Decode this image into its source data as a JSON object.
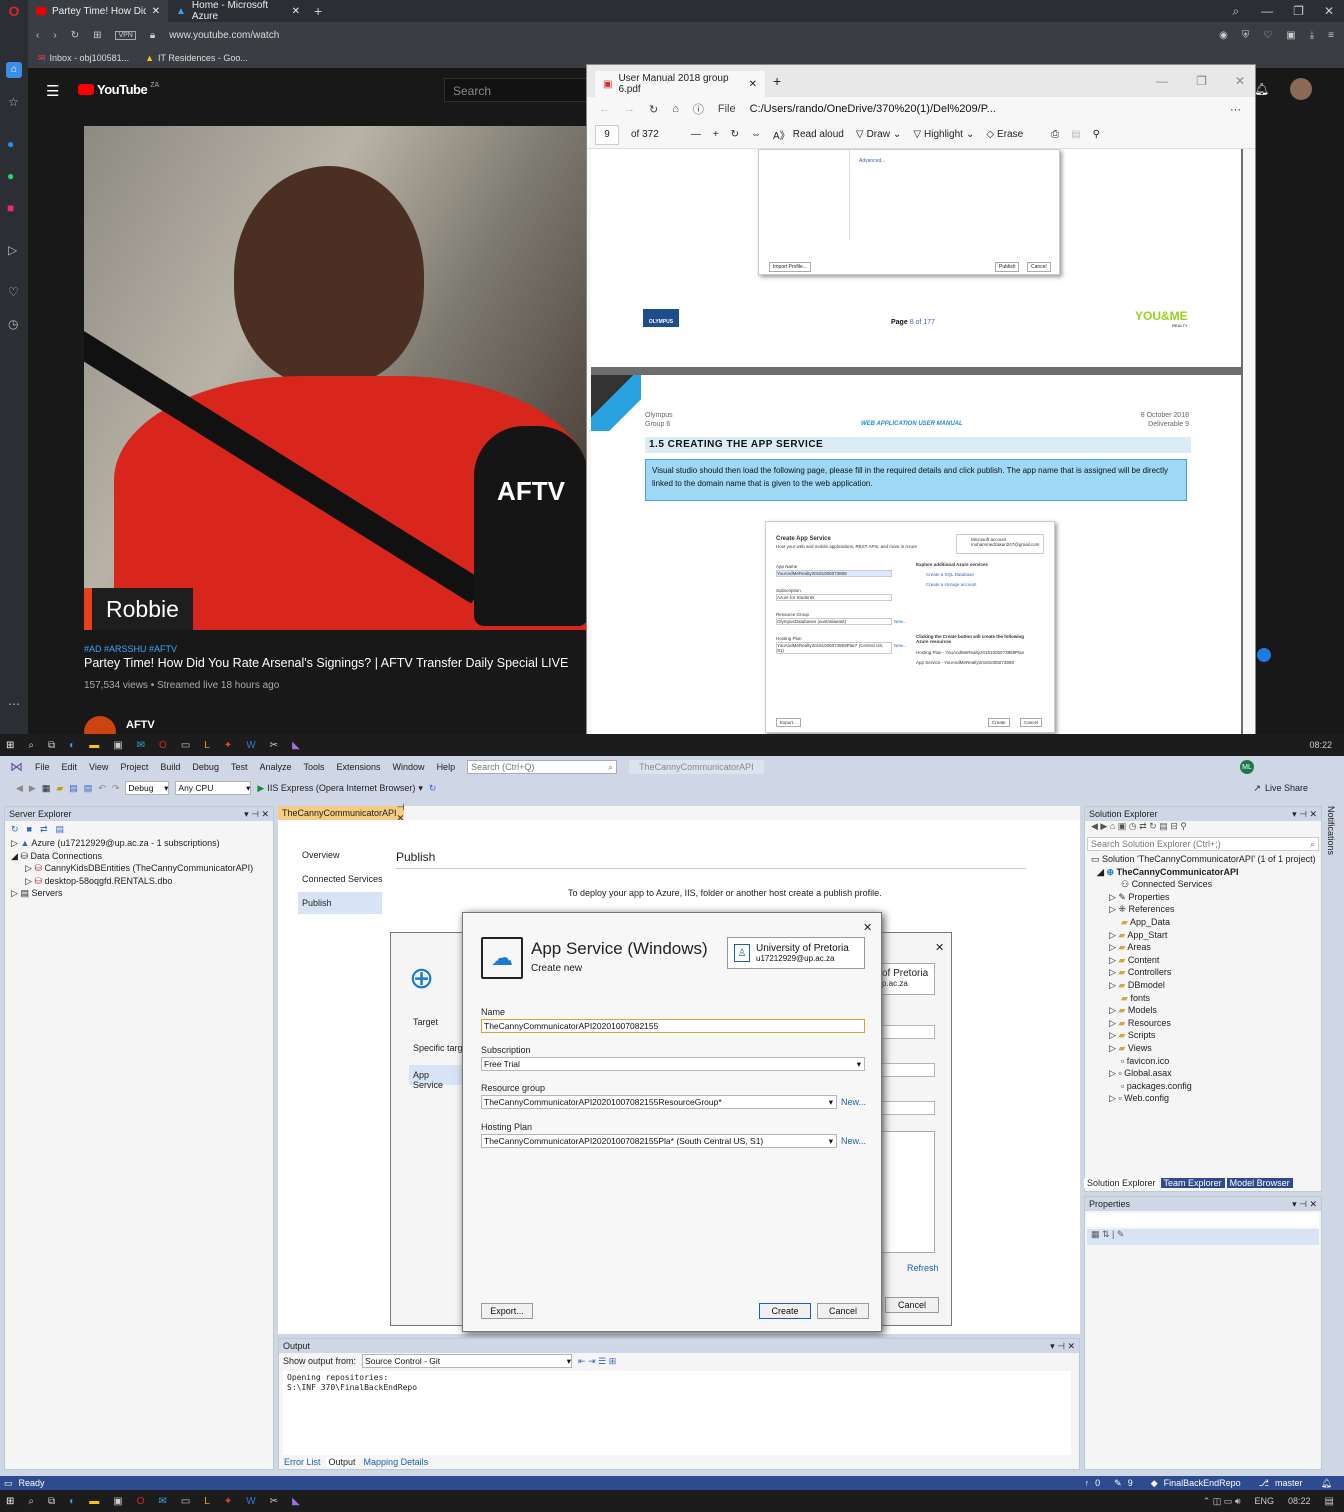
{
  "browser": {
    "tabs": [
      {
        "label": "Partey Time! How Did You"
      },
      {
        "label": "Home - Microsoft Azure"
      }
    ],
    "url": "www.youtube.com/watch",
    "vpn": "VPN",
    "bookmarks": [
      {
        "label": "Inbox - obj100581..."
      },
      {
        "label": "IT Residences - Goo..."
      }
    ]
  },
  "youtube": {
    "logo": "YouTube",
    "region": "ZA",
    "search_placeholder": "Search",
    "name_tag": "Robbie",
    "mic_label": "AFTV",
    "hashtags": "#AD #ARSSHU #AFTV",
    "title": "Partey Time! How Did You Rate Arsenal's Signings? | AFTV Transfer Daily Special LIVE",
    "meta": "157,534 views • Streamed live 18 hours ago",
    "channel": "AFTV"
  },
  "pdf": {
    "tab_title": "User Manual 2018 group 6.pdf",
    "address_prefix": "File",
    "address": "C:/Users/rando/OneDrive/370%20(1)/Del%209/P...",
    "page_num": "9",
    "page_total": "of 372",
    "tools": {
      "read_aloud": "Read aloud",
      "draw": "Draw",
      "highlight": "Highlight",
      "erase": "Erase"
    },
    "page8": {
      "advanced": "Advanced...",
      "import": "Import Profile...",
      "publish": "Publish",
      "cancel": "Cancel",
      "footer_logo": "OLYMPUS",
      "footer_page_a": "Page ",
      "footer_page_b": "8",
      "footer_page_c": " of 177",
      "right_logo": "YOU&ME",
      "right_sub": "REALTY"
    },
    "page9": {
      "left_head": "Olympus",
      "left_sub": "Group 6",
      "center_head": "WEB APPLICATION USER MANUAL",
      "right_head": "8 October 2018",
      "right_sub": "Deliverable 9",
      "section": "1.5 CREATING THE APP SERVICE",
      "callout": "Visual studio should then load the following page, please fill in the required details and click publish. The app name that is assigned will be directly linked to the domain name that is given to the web application.",
      "shot": {
        "title": "Create App Service",
        "sub": "Host your web and mobile applications, REST APIs, and more in Azure",
        "account": "Microsoft account",
        "account_email": "mohammedzakari247@gmail.com",
        "app_name_lbl": "App Name",
        "app_name": "YouAndMeRealty20181005073859",
        "subscription_lbl": "Subscription",
        "subscription": "Azure for Students",
        "rg_lbl": "Resource Group",
        "rg": "OlympusDatabases (australiaeast)",
        "hp_lbl": "Hosting Plan",
        "hp": "YouAndMeRealty20181005073859Plan* (Central US, S1)",
        "new1": "New...",
        "new2": "New...",
        "explore": "Explore additional Azure services",
        "sql": "Create a SQL Database",
        "storage": "Create a storage account",
        "clicking": "Clicking the Create button will create the following Azure resources",
        "res1": "Hosting Plan - YouAndMeRealty20181005073859Plan",
        "res2": "App Service - YouAndMeRealty20181005073859",
        "export": "Export...",
        "create": "Create",
        "cancel": "Cancel"
      }
    }
  },
  "taskbar": {
    "time": "08:22",
    "lang": "ENG"
  },
  "vs": {
    "menu": [
      "File",
      "Edit",
      "View",
      "Project",
      "Build",
      "Debug",
      "Test",
      "Analyze",
      "Tools",
      "Extensions",
      "Window",
      "Help"
    ],
    "search": "Search (Ctrl+Q)",
    "solution_title": "TheCannyCommunicatorAPI",
    "user_initials": "ML",
    "config": "Debug",
    "platform": "Any CPU",
    "run_target": "IIS Express (Opera Internet Browser)",
    "live_share": "Live Share",
    "server_explorer": {
      "title": "Server Explorer",
      "items": [
        {
          "label": "Azure (u17212929@up.ac.za - 1 subscriptions)"
        },
        {
          "label": "Data Connections"
        },
        {
          "label": "CannyKidsDBEntities (TheCannyCommunicatorAPI)"
        },
        {
          "label": "desktop-58oqgfd.RENTALS.dbo"
        },
        {
          "label": "Servers"
        }
      ]
    },
    "doc_tab": "TheCannyCommunicatorAPI",
    "publish": {
      "nav": [
        "Overview",
        "Connected Services",
        "Publish"
      ],
      "title": "Publish",
      "deploy_text": "To deploy your app to Azure, IIS, folder or another host create a publish profile.",
      "back": {
        "steps": [
          "Target",
          "Specific targe",
          "App Service"
        ],
        "account_partial": "of Pretoria",
        "email_partial": "p.ac.za",
        "refresh": "Refresh",
        "cancel": "Cancel"
      }
    },
    "dialog": {
      "title": "App Service (Windows)",
      "subtitle": "Create new",
      "account": "University of Pretoria",
      "email": "u17212929@up.ac.za",
      "name_lbl": "Name",
      "name": "TheCannyCommunicatorAPI20201007082155",
      "sub_lbl": "Subscription",
      "sub": "Free Trial",
      "rg_lbl": "Resource group",
      "rg": "TheCannyCommunicatorAPI20201007082155ResourceGroup*",
      "new1": "New...",
      "hp_lbl": "Hosting Plan",
      "hp": "TheCannyCommunicatorAPI20201007082155Pla* (South Central US, S1)",
      "new2": "New...",
      "export": "Export...",
      "create": "Create",
      "cancel": "Cancel"
    },
    "output": {
      "title": "Output",
      "show_from": "Show output from:",
      "source": "Source Control - Git",
      "line1": "Opening repositories:",
      "line2": "S:\\INF 370\\FinalBackEndRepo",
      "tabs": [
        "Error List",
        "Output",
        "Mapping Details"
      ]
    },
    "solution_explorer": {
      "title": "Solution Explorer",
      "search": "Search Solution Explorer (Ctrl+;)",
      "solution": "Solution 'TheCannyCommunicatorAPI' (1 of 1 project)",
      "project": "TheCannyCommunicatorAPI",
      "items": [
        "Connected Services",
        "Properties",
        "References",
        "App_Data",
        "App_Start",
        "Areas",
        "Content",
        "Controllers",
        "DBmodel",
        "fonts",
        "Models",
        "Resources",
        "Scripts",
        "Views",
        "favicon.ico",
        "Global.asax",
        "packages.config",
        "Web.config"
      ],
      "tabs": [
        "Solution Explorer",
        "Team Explorer",
        "Model Browser"
      ]
    },
    "properties": {
      "title": "Properties"
    },
    "notifications": "Notifications",
    "status": {
      "ready": "Ready",
      "up": "0",
      "pencil": "9",
      "repo": "FinalBackEndRepo",
      "branch": "master"
    }
  }
}
